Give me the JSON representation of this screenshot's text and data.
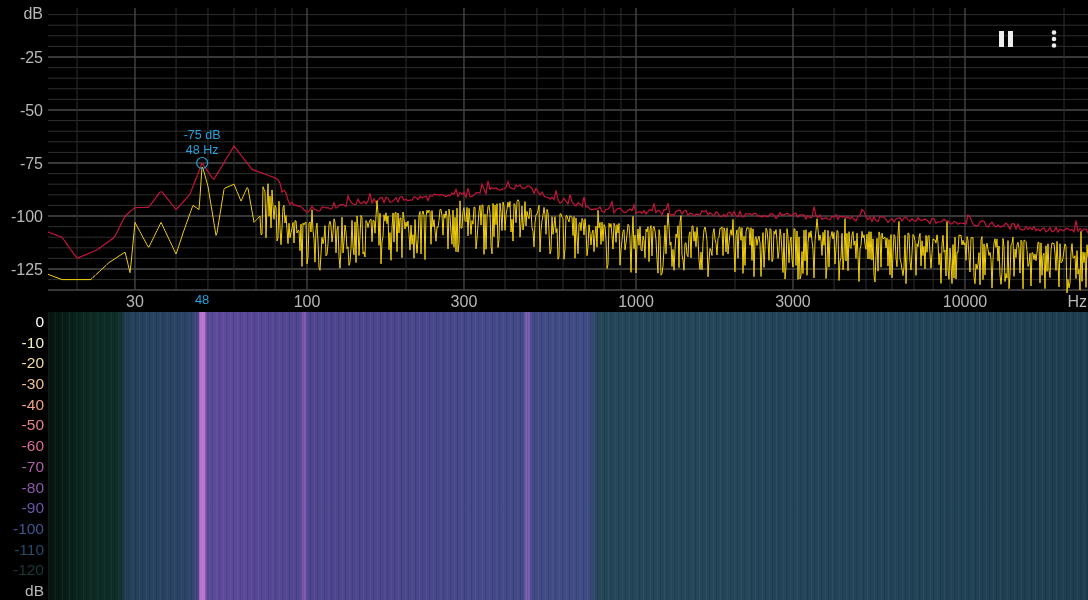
{
  "spectrum": {
    "y_unit": "dB",
    "y_ticks": [
      "-25",
      "-50",
      "-75",
      "-100",
      "-125"
    ],
    "x_ticks": [
      "30",
      "100",
      "300",
      "1000",
      "3000",
      "10000"
    ],
    "x_unit": "Hz",
    "peak": {
      "level_label": "-75 dB",
      "freq_label": "48 Hz",
      "axis_label": "48"
    }
  },
  "spectrogram": {
    "scale": [
      {
        "label": "0",
        "color": "#ffffff"
      },
      {
        "label": "-10",
        "color": "#f2efc0"
      },
      {
        "label": "-20",
        "color": "#efd9a0"
      },
      {
        "label": "-30",
        "color": "#efbf8e"
      },
      {
        "label": "-40",
        "color": "#ee9f84"
      },
      {
        "label": "-50",
        "color": "#e6808a"
      },
      {
        "label": "-60",
        "color": "#d86a98"
      },
      {
        "label": "-70",
        "color": "#b05ea8"
      },
      {
        "label": "-80",
        "color": "#8a5aae"
      },
      {
        "label": "-90",
        "color": "#6a56a8"
      },
      {
        "label": "-100",
        "color": "#3e5590"
      },
      {
        "label": "-110",
        "color": "#244a68"
      },
      {
        "label": "-120",
        "color": "#1a3a3a"
      }
    ],
    "unit": "dB"
  }
}
